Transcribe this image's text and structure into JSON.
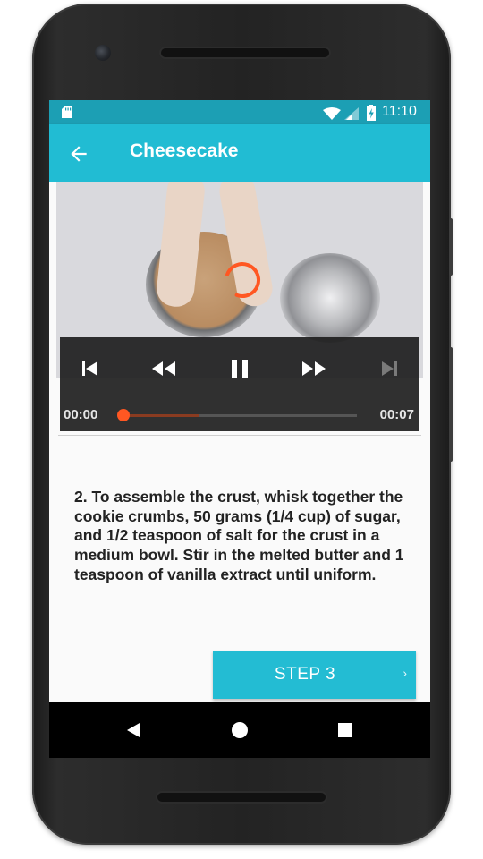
{
  "status_bar": {
    "time": "11:10",
    "icons": [
      "sd-card-icon",
      "wifi-icon",
      "cell-signal-icon",
      "battery-charging-icon"
    ]
  },
  "app_bar": {
    "back_icon": "arrow-back-icon",
    "title": "Cheesecake"
  },
  "player": {
    "buttons": [
      "skip-previous-icon",
      "rewind-icon",
      "pause-icon",
      "fast-forward-icon",
      "skip-next-icon"
    ],
    "position": "00:00",
    "duration": "00:07",
    "progress": 0.0,
    "loading": true
  },
  "step": {
    "description": "2. To assemble the crust, whisk together the cookie crumbs, 50 grams (1/4 cup) of sugar, and 1/2 teaspoon of salt for the crust in a medium bowl. Stir in the melted butter and 1 teaspoon of vanilla extract until uniform."
  },
  "next_button": {
    "label": "STEP 3",
    "chevron": "›"
  },
  "navigation": [
    "back-triangle-icon",
    "home-circle-icon",
    "recents-square-icon"
  ],
  "colors": {
    "status_bar": "#1c9fb4",
    "app_bar": "#21bcd3",
    "accent": "#ff5722",
    "button": "#23bcd3"
  }
}
